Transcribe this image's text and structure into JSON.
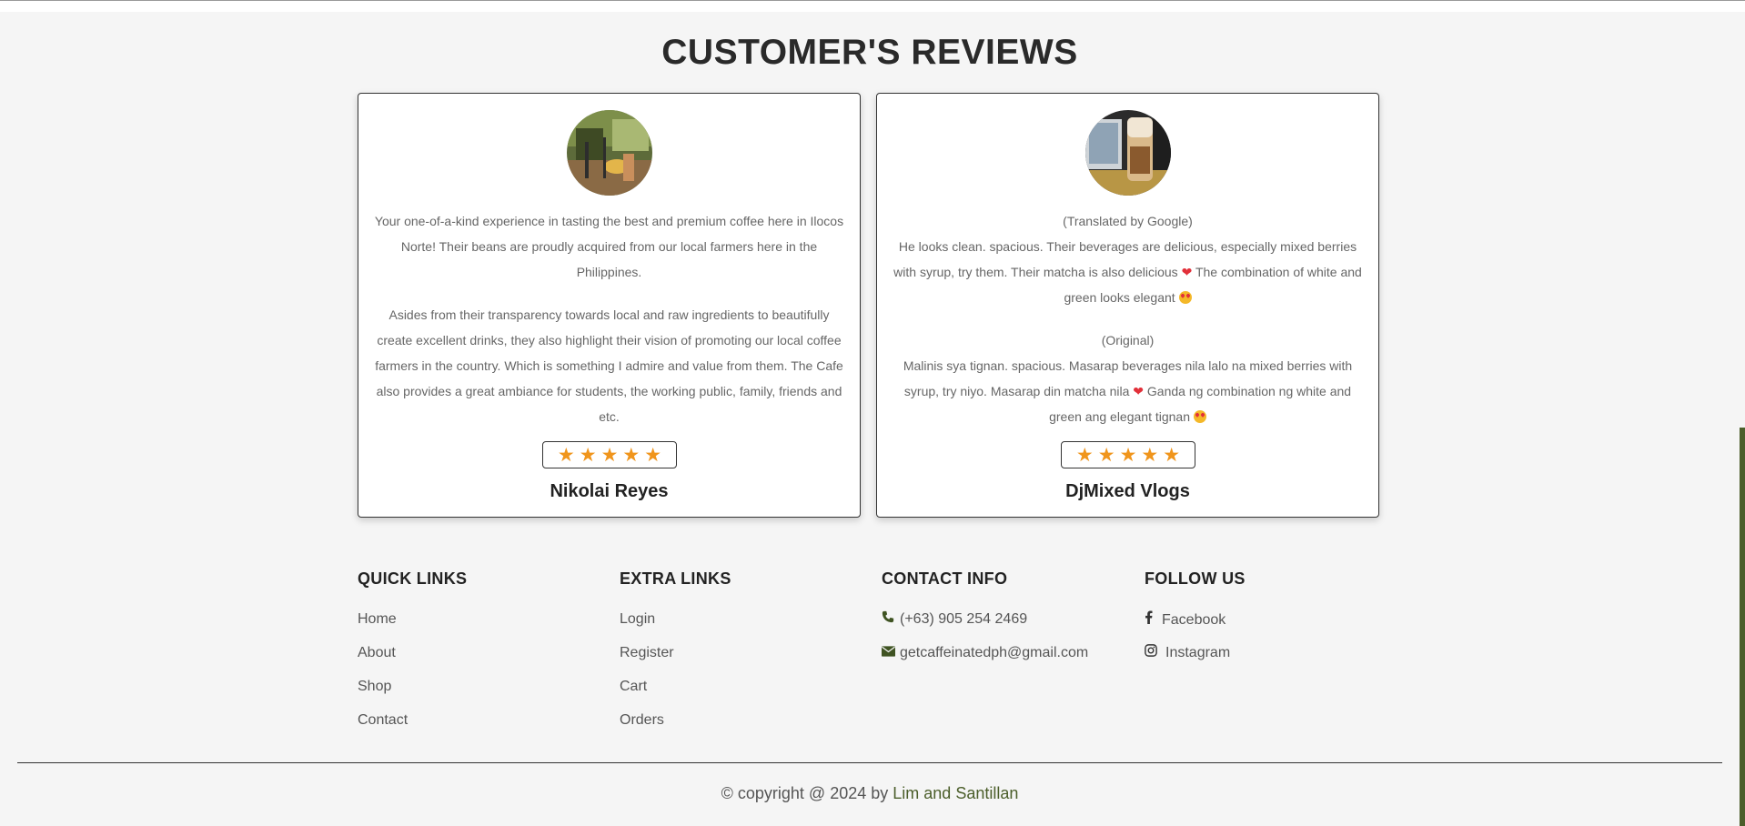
{
  "section": {
    "title": "CUSTOMER'S REVIEWS"
  },
  "reviews": [
    {
      "paragraphs": [
        "Your one-of-a-kind experience in tasting the best and premium coffee here in Ilocos Norte! Their beans are proudly acquired from our local farmers here in the Philippines.",
        "Asides from their transparency towards local and raw ingredients to beautifully create excellent drinks, they also highlight their vision of promoting our local coffee farmers in the country. Which is something I admire and value from them. The Cafe also provides a great ambiance for students, the working public, family, friends and etc."
      ],
      "rating": 5,
      "name": "Nikolai Reyes"
    },
    {
      "translated_label": "(Translated by Google)",
      "translated_a": "He looks clean. spacious. Their beverages are delicious, especially mixed berries with syrup, try them. Their matcha is also delicious",
      "translated_b": "The combination of white and green looks elegant",
      "original_label": "(Original)",
      "original_a": "Malinis sya tignan. spacious. Masarap beverages nila lalo na mixed berries with syrup, try niyo. Masarap din matcha nila",
      "original_b": "Ganda ng combination ng white and green ang elegant tignan",
      "rating": 5,
      "name": "DjMixed Vlogs"
    }
  ],
  "footer": {
    "quick_links": {
      "heading": "QUICK LINKS",
      "items": [
        "Home",
        "About",
        "Shop",
        "Contact"
      ]
    },
    "extra_links": {
      "heading": "EXTRA LINKS",
      "items": [
        "Login",
        "Register",
        "Cart",
        "Orders"
      ]
    },
    "contact_info": {
      "heading": "CONTACT INFO",
      "phone": "(+63) 905 254 2469",
      "email": "getcaffeinatedph@gmail.com"
    },
    "follow_us": {
      "heading": "FOLLOW US",
      "facebook": "Facebook",
      "instagram": "Instagram"
    },
    "copyright_prefix": "© copyright @ 2024 by",
    "copyright_authors": "Lim and Santillan"
  },
  "icons": {
    "star": "star-icon",
    "heart": "heart-icon",
    "heart_eyes": "heart-eyes-emoji",
    "phone": "phone-icon",
    "email": "envelope-icon",
    "facebook": "facebook-icon",
    "instagram": "instagram-icon"
  },
  "colors": {
    "accent": "#4b5e2a",
    "star": "#f0951c",
    "background": "#f5f5f5",
    "card": "#ffffff"
  }
}
